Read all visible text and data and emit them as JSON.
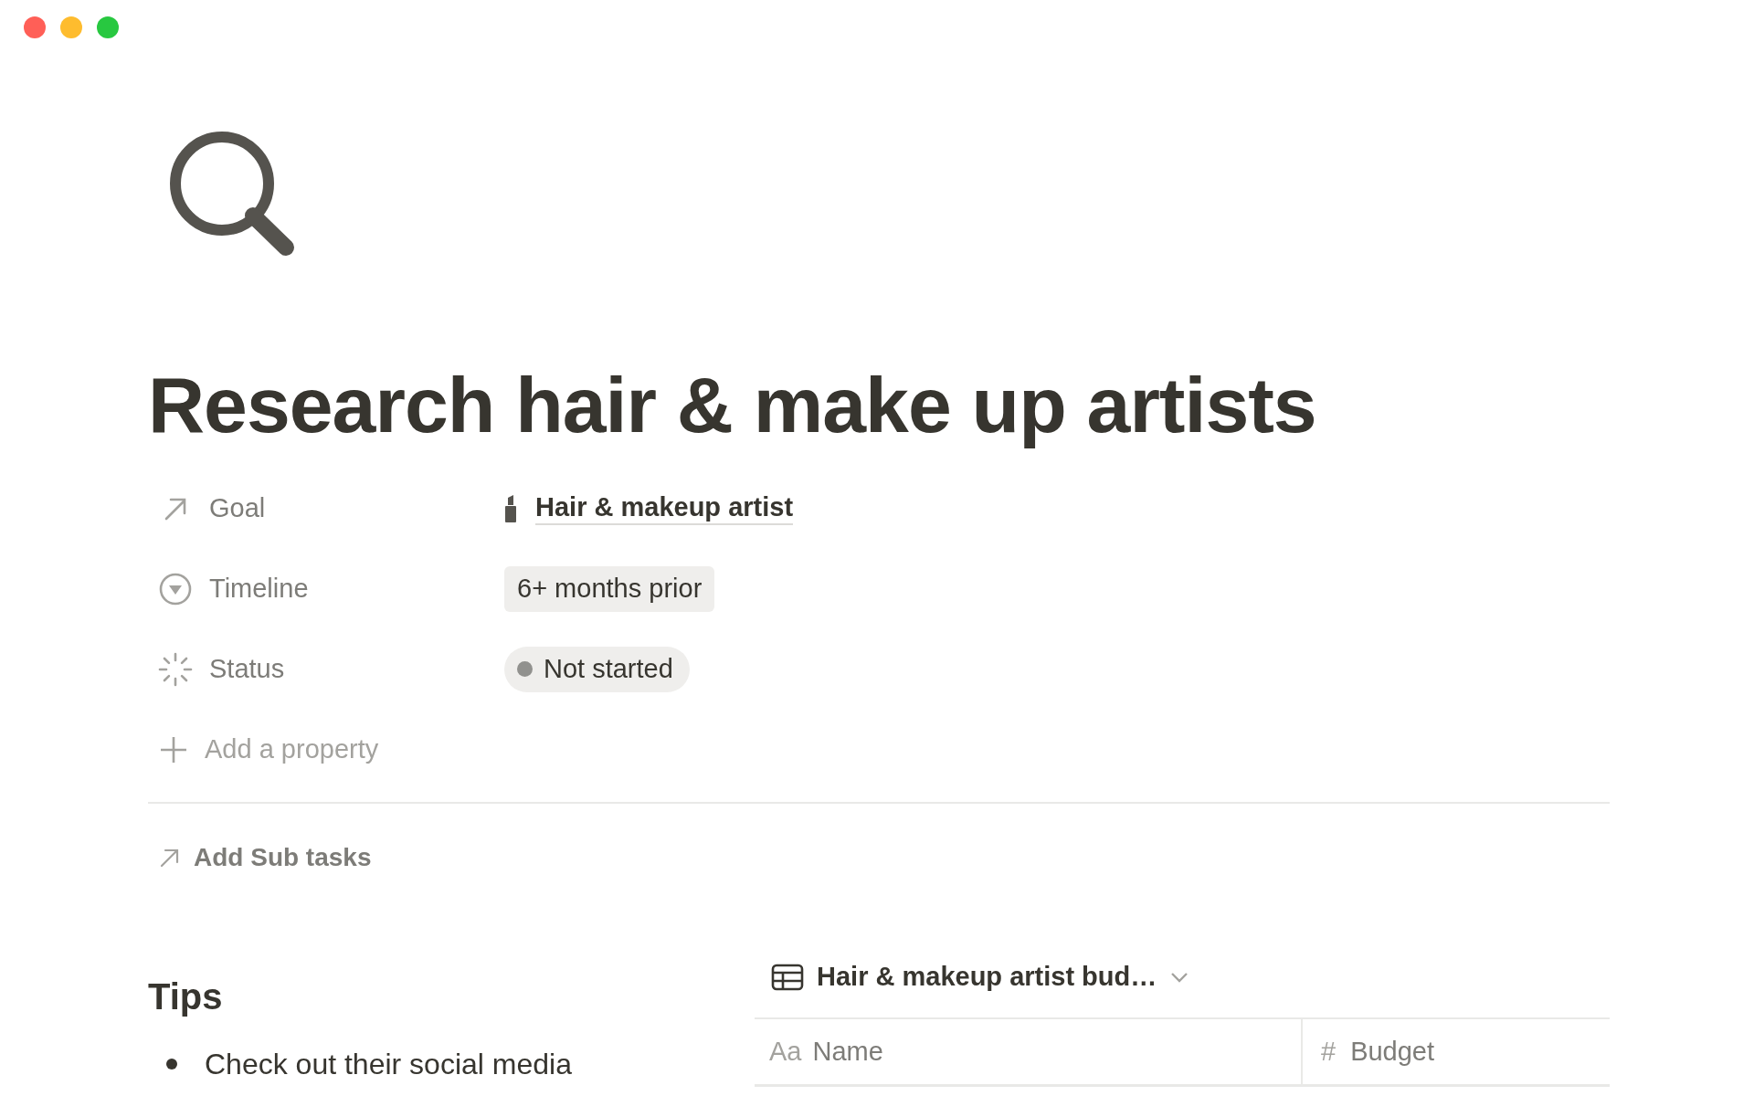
{
  "window": {
    "controls": [
      {
        "color": "#ff5f57"
      },
      {
        "color": "#febc2e"
      },
      {
        "color": "#28c840"
      }
    ]
  },
  "page": {
    "title": "Research hair & make up artists",
    "properties": [
      {
        "kind": "relation",
        "label": "Goal",
        "value": "Hair & makeup artist"
      },
      {
        "kind": "select",
        "label": "Timeline",
        "value": "6+ months prior"
      },
      {
        "kind": "status",
        "label": "Status",
        "value": "Not started"
      }
    ],
    "add_property": "Add a property",
    "sub_tasks": "Add Sub tasks",
    "tips": {
      "heading": "Tips",
      "items": [
        "Check out their social media"
      ]
    },
    "database": {
      "title": "Hair & makeup artist bud…",
      "columns": [
        {
          "type_label": "Aa",
          "label": "Name"
        },
        {
          "type_label": "#",
          "label": "Budget"
        }
      ]
    }
  }
}
